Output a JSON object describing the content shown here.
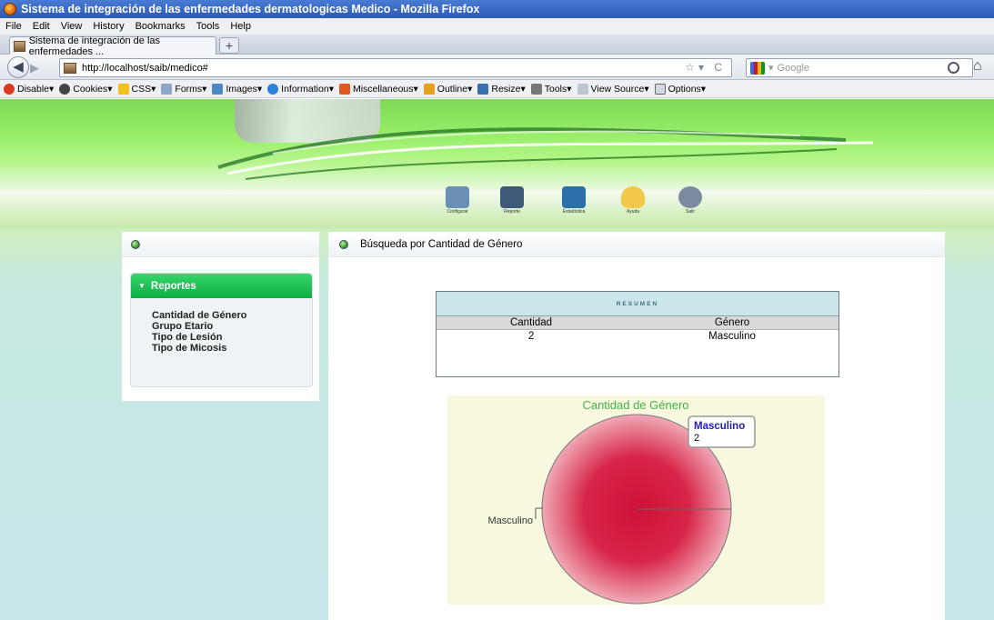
{
  "browser": {
    "title": "Sistema de integración de las enfermedades dermatologicas Medico - Mozilla Firefox",
    "menu": [
      "File",
      "Edit",
      "View",
      "History",
      "Bookmarks",
      "Tools",
      "Help"
    ],
    "tab_label": "Sistema de integración de las enfermedades ...",
    "new_tab": "+",
    "url": "http://localhost/saib/medico#",
    "search_placeholder": "Google",
    "devbar": [
      "Disable",
      "Cookies",
      "CSS",
      "Forms",
      "Images",
      "Information",
      "Miscellaneous",
      "Outline",
      "Resize",
      "Tools",
      "View Source",
      "Options"
    ]
  },
  "site_nav": [
    {
      "label": "Configurar",
      "color": "#6b8fb5"
    },
    {
      "label": "Reporte",
      "color": "#3e5a78"
    },
    {
      "label": "Estadística",
      "color": "#2d6fa8"
    },
    {
      "label": "Ayuda",
      "color": "#f2c84b"
    },
    {
      "label": "Salir",
      "color": "#7c8aa0"
    }
  ],
  "sidebar": {
    "section": "Reportes",
    "items": [
      "Cantidad de Género",
      "Grupo Etario",
      "Tipo de Lesión",
      "Tipo de Micosis"
    ]
  },
  "main": {
    "title": "Búsqueda por Cantidad de Género",
    "summary": {
      "caption": "RESUMEN",
      "headers": [
        "Cantidad",
        "Género"
      ],
      "rows": [
        [
          "2",
          "Masculino"
        ]
      ]
    }
  },
  "chart_data": {
    "type": "pie",
    "title": "Cantidad de Género",
    "slices": [
      {
        "label": "Masculino",
        "value": 2
      }
    ],
    "tooltip": {
      "label": "Masculino",
      "value": "2"
    },
    "colors": {
      "slice": "#d8173d",
      "title": "#43b24a",
      "background": "#f8f8df"
    }
  }
}
